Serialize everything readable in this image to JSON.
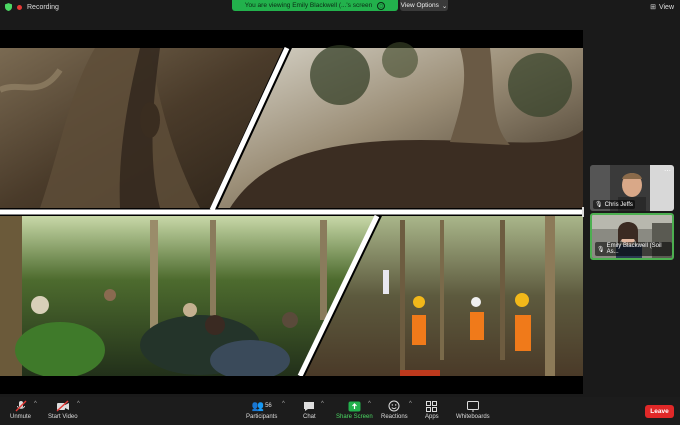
{
  "topbar": {
    "recording_label": "Recording",
    "viewing_text": "You are viewing Emily Blackwell (...'s screen",
    "view_options_label": "View Options",
    "view_label": "View"
  },
  "participants": [
    {
      "name": "Chris Jeffs"
    },
    {
      "name": "Emily Blackwell (Soil As..."
    }
  ],
  "toolbar": {
    "unmute_label": "Unmute",
    "start_video_label": "Start Video",
    "participants_label": "Participants",
    "participants_count": "56",
    "chat_label": "Chat",
    "share_label": "Share Screen",
    "reactions_label": "Reactions",
    "apps_label": "Apps",
    "whiteboards_label": "Whiteboards",
    "leave_label": "Leave"
  },
  "colors": {
    "share_banner": "#22b14c",
    "leave": "#e02828",
    "active_speaker_border": "#4caf50"
  }
}
